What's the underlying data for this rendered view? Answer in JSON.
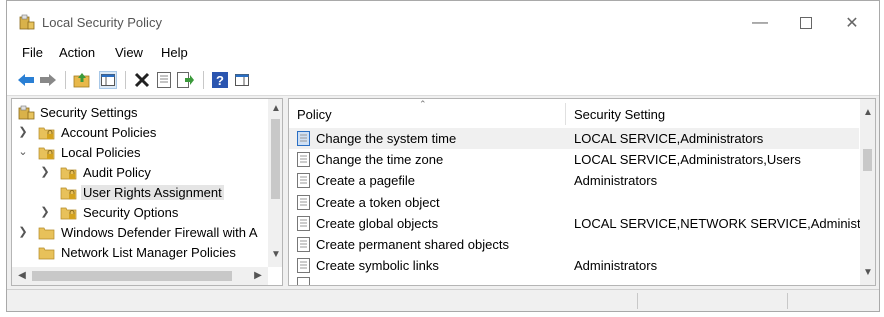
{
  "window": {
    "title": "Local Security Policy"
  },
  "menu": {
    "items": [
      "File",
      "Action",
      "View",
      "Help"
    ]
  },
  "toolbar": {
    "icons": [
      "back-arrow-icon",
      "forward-arrow-icon",
      "up-folder-icon",
      "show-hide-tree-icon",
      "delete-icon",
      "properties-icon",
      "export-list-icon",
      "help-icon",
      "show-hide-action-pane-icon"
    ]
  },
  "tree": {
    "items": [
      {
        "label": "Security Settings"
      },
      {
        "label": "Account Policies"
      },
      {
        "label": "Local Policies"
      },
      {
        "label": "Audit Policy"
      },
      {
        "label": "User Rights Assignment"
      },
      {
        "label": "Security Options"
      },
      {
        "label": "Windows Defender Firewall with A"
      },
      {
        "label": "Network List Manager Policies"
      }
    ]
  },
  "list": {
    "columns": {
      "policy": "Policy",
      "setting": "Security Setting"
    },
    "rows": [
      {
        "policy": "Change the system time",
        "setting": "LOCAL SERVICE,Administrators"
      },
      {
        "policy": "Change the time zone",
        "setting": "LOCAL SERVICE,Administrators,Users"
      },
      {
        "policy": "Create a pagefile",
        "setting": "Administrators"
      },
      {
        "policy": "Create a token object",
        "setting": ""
      },
      {
        "policy": "Create global objects",
        "setting": "LOCAL SERVICE,NETWORK SERVICE,Administr..."
      },
      {
        "policy": "Create permanent shared objects",
        "setting": ""
      },
      {
        "policy": "Create symbolic links",
        "setting": "Administrators"
      }
    ]
  },
  "colors": {
    "selected_row": "#e5e5e5",
    "highlight_row": "#f0f0f0",
    "folder": "#e8b84a"
  }
}
